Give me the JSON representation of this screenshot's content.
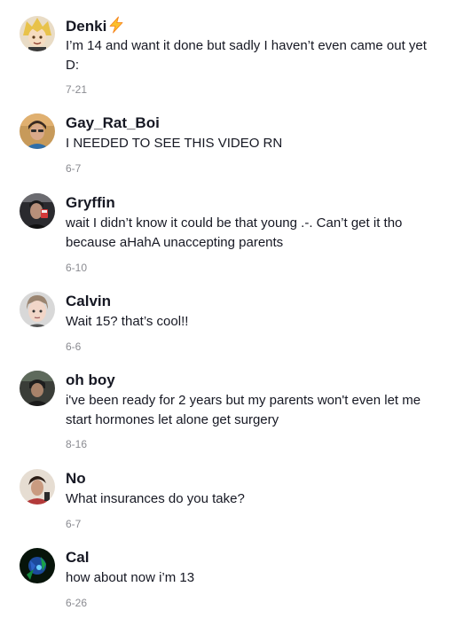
{
  "comments": [
    {
      "username": "Denki",
      "badge": "lightning-bolt-icon",
      "text": "I’m 14 and want it done but sadly I haven’t even came out yet D:",
      "date": "7-21"
    },
    {
      "username": "Gay_Rat_Boi",
      "text": "I NEEDED TO SEE THIS VIDEO RN",
      "date": "6-7"
    },
    {
      "username": "Gryffin",
      "text": "wait I didn’t know it could be that young .-. Can’t get it tho because aHahA unaccepting parents",
      "date": "6-10"
    },
    {
      "username": "Calvin",
      "text": "Wait 15? that’s cool!!",
      "date": "6-6"
    },
    {
      "username": "oh boy",
      "text": "i've been ready for 2 years but my parents won't even let me start hormones let alone get surgery",
      "date": "8-16"
    },
    {
      "username": "No",
      "text": "What insurances do you take?",
      "date": "6-7"
    },
    {
      "username": "Cal",
      "text": "how about now i’m 13",
      "date": "6-26"
    }
  ],
  "colors": {
    "text": "#161823",
    "date": "#8a8b91",
    "bolt": "#fbc02d"
  }
}
